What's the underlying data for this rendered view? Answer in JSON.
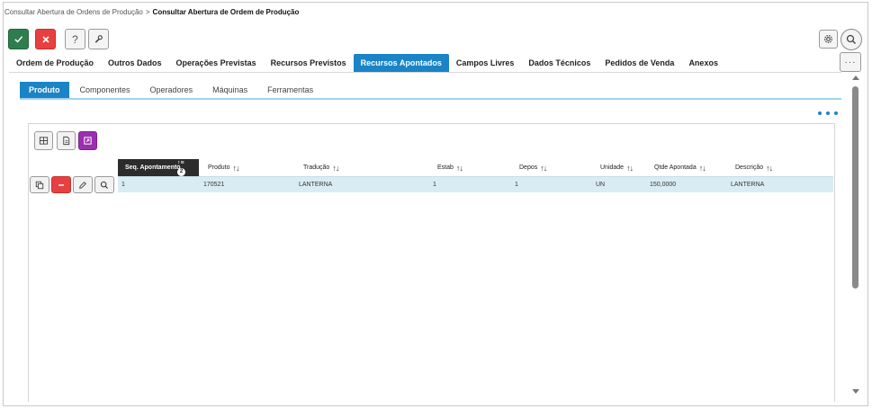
{
  "breadcrumb": {
    "parent": "Consultar Abertura de Ordens de Produção",
    "separator": ">",
    "current": "Consultar Abertura de Ordem de Produção"
  },
  "toolbar": {
    "help_label": "?",
    "confirm_icon": "check-icon",
    "cancel_icon": "close-icon",
    "tool_icon": "wrench-icon",
    "confirm_color": "#2e7d4f",
    "cancel_color": "#e74040"
  },
  "top_right": {
    "gear_icon": "gear-icon",
    "search_icon": "search-icon",
    "more_label": "···"
  },
  "main_tabs": [
    {
      "label": "Ordem de Produção"
    },
    {
      "label": "Outros Dados"
    },
    {
      "label": "Operações Previstas"
    },
    {
      "label": "Recursos Previstos"
    },
    {
      "label": "Recursos Apontados"
    },
    {
      "label": "Campos Livres"
    },
    {
      "label": "Dados Técnicos"
    },
    {
      "label": "Pedidos de Venda"
    },
    {
      "label": "Anexos"
    }
  ],
  "main_tabs_active": "Recursos Apontados",
  "sub_tabs": [
    {
      "label": "Produto"
    },
    {
      "label": "Componentes"
    },
    {
      "label": "Operadores"
    },
    {
      "label": "Máquinas"
    },
    {
      "label": "Ferramentas"
    }
  ],
  "sub_tabs_active": "Produto",
  "accent_color": "#1a84c7",
  "grid": {
    "columns": [
      {
        "label": "Seq. Apontamento",
        "sort_badge": "2"
      },
      {
        "label": "Produto"
      },
      {
        "label": "Tradução"
      },
      {
        "label": "Estab"
      },
      {
        "label": "Depos"
      },
      {
        "label": "Unidade"
      },
      {
        "label": "Qtde Apontada"
      },
      {
        "label": "Descrição"
      }
    ],
    "rows": [
      {
        "seq": "1",
        "produto": "170521",
        "traducao": "LANTERNA",
        "estab": "1",
        "depos": "1",
        "unidade": "UN",
        "qtde": "150,0000",
        "descricao": "LANTERNA"
      }
    ]
  }
}
